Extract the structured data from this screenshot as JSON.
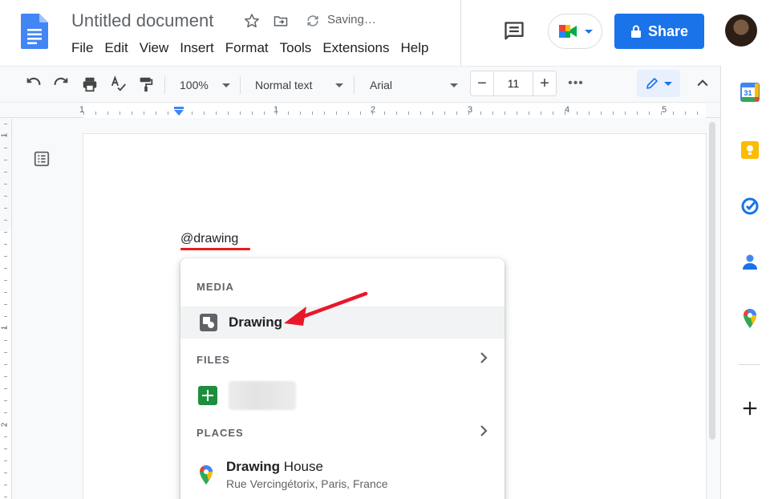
{
  "doc": {
    "title": "Untitled document",
    "status": "Saving…"
  },
  "menu": [
    "File",
    "Edit",
    "View",
    "Insert",
    "Format",
    "Tools",
    "Extensions",
    "Help"
  ],
  "header": {
    "share_label": "Share",
    "icons": [
      "star-icon",
      "move-icon",
      "sync-icon",
      "comment-icon",
      "meet-icon",
      "lock-icon"
    ]
  },
  "toolbar": {
    "zoom": "100%",
    "style": "Normal text",
    "font": "Arial",
    "font_size": "11",
    "more": "•••"
  },
  "ruler": {
    "top_labels": [
      "1",
      "1",
      "2",
      "3",
      "4",
      "5"
    ],
    "left_labels": [
      "1",
      "1",
      "2"
    ]
  },
  "editor": {
    "typed_text": "@drawing"
  },
  "popup": {
    "media_header": "MEDIA",
    "drawing_label": "Drawing",
    "files_header": "FILES",
    "places_header": "PLACES",
    "place_name_bold": "Drawing",
    "place_name_rest": " House",
    "place_address": "Rue Vercingétorix, Paris, France"
  },
  "sidepanel": {
    "calendar_day": "31",
    "items": [
      "calendar-icon",
      "keep-icon",
      "tasks-icon",
      "contacts-icon",
      "maps-icon",
      "add-icon"
    ]
  },
  "colors": {
    "accent": "#1a73e8",
    "annotation_red": "#e8182b",
    "sheets_green": "#1e8e3e"
  }
}
